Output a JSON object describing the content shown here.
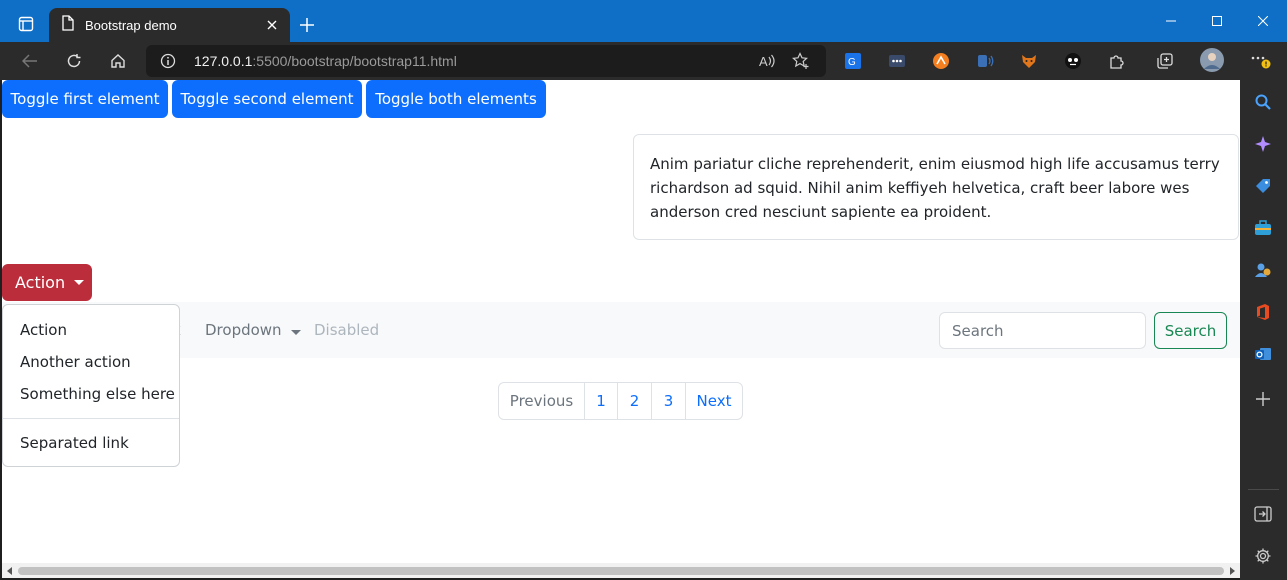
{
  "browser": {
    "tab_title": "Bootstrap demo",
    "url_host": "127.0.0.1",
    "url_rest": ":5500/bootstrap/bootstrap11.html",
    "accent": "#0f6fc6"
  },
  "page": {
    "toggle_buttons": [
      "Toggle first element",
      "Toggle second element",
      "Toggle both elements"
    ],
    "collapse_text": "Anim pariatur cliche reprehenderit, enim eiusmod high life accusamus terry richardson ad squid. Nihil anim keffiyeh helvetica, craft beer labore wes anderson cred nesciunt sapiente ea proident.",
    "action_button": "Action",
    "dropdown_items": [
      "Action",
      "Another action",
      "Something else here"
    ],
    "dropdown_separated": "Separated link",
    "navbar": {
      "link_partial": "k",
      "dropdown_label": "Dropdown",
      "disabled_label": "Disabled",
      "search_placeholder": "Search",
      "search_button": "Search"
    },
    "pagination": [
      "Previous",
      "1",
      "2",
      "3",
      "Next"
    ],
    "colors": {
      "primary": "#0d6efd",
      "danger": "#bb2d3b",
      "success": "#198754"
    }
  }
}
